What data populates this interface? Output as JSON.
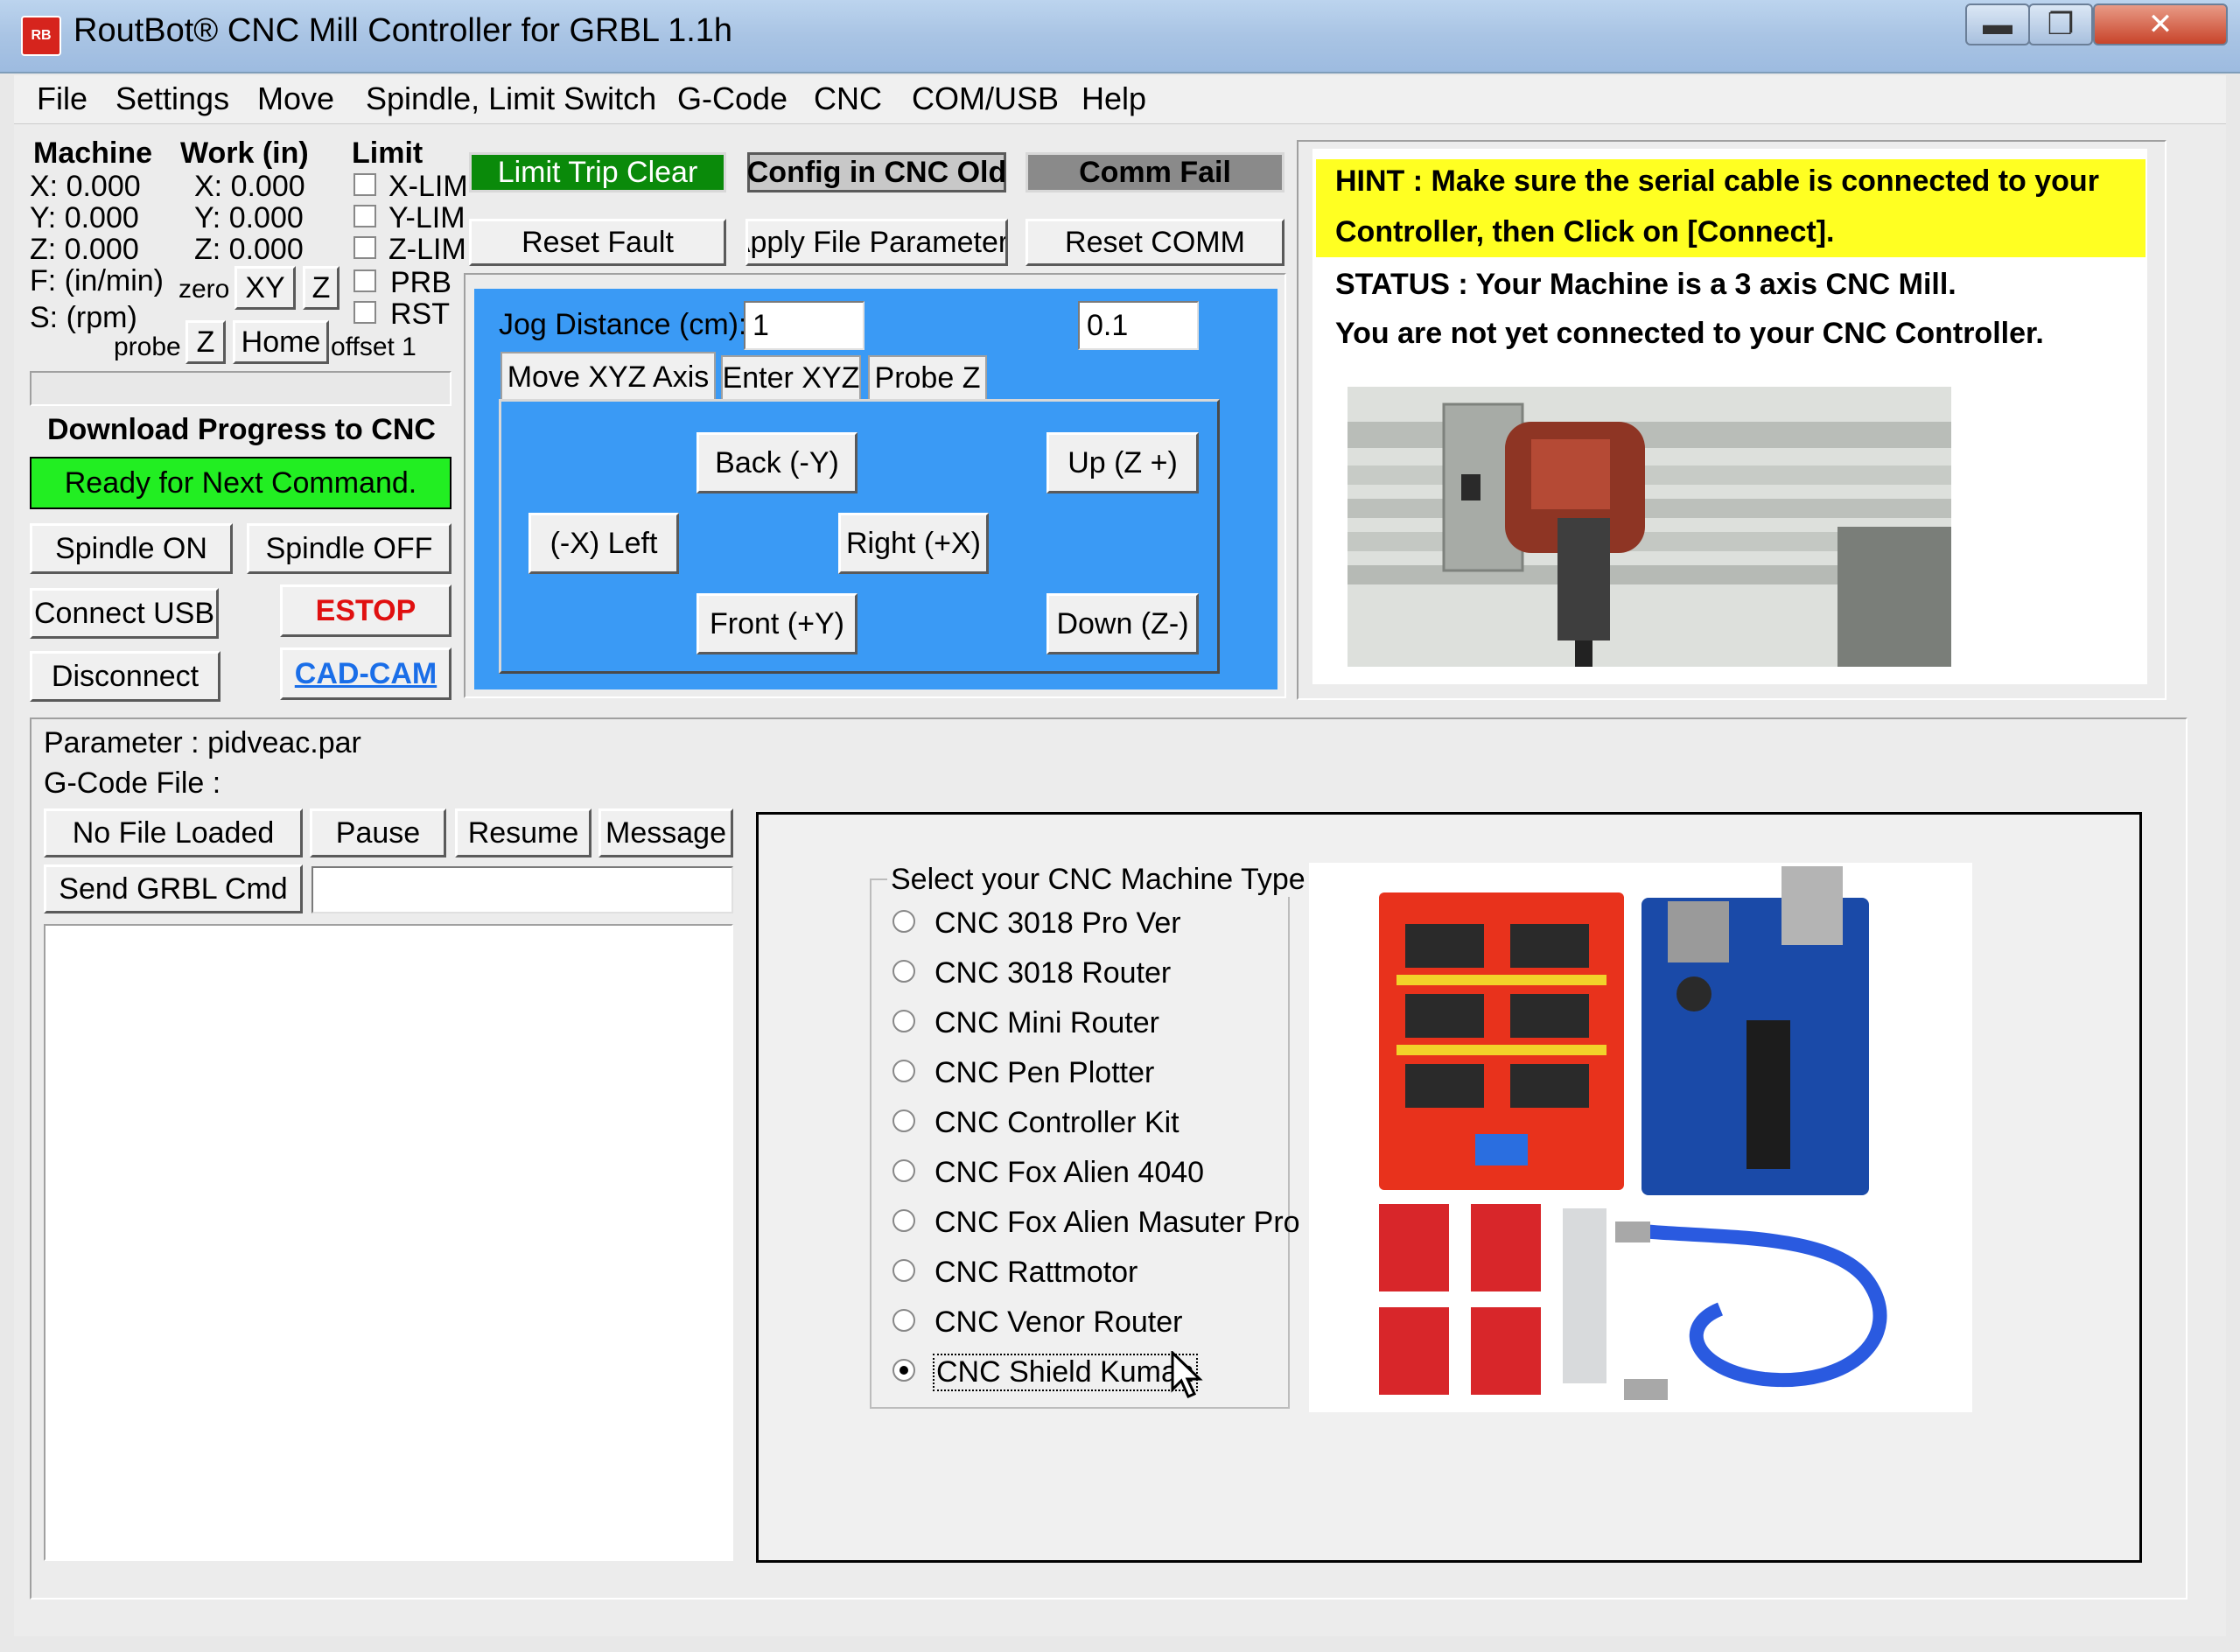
{
  "window": {
    "title": "RoutBot® CNC Mill Controller for GRBL 1.1h",
    "icon_label": "RB",
    "min_glyph": "▬",
    "max_glyph": "❐",
    "close_glyph": "✕"
  },
  "menu": [
    "File",
    "Settings",
    "Move",
    "Spindle, Limit Switch",
    "G-Code",
    "CNC",
    "COM/USB",
    "Help"
  ],
  "coords": {
    "machine_header": "Machine",
    "work_header": "Work (in)",
    "limit_header": "Limit",
    "machine": [
      "X: 0.000",
      "Y: 0.000",
      "Z: 0.000",
      "F: (in/min)",
      "S: (rpm)"
    ],
    "work": [
      "X: 0.000",
      "Y: 0.000",
      "Z: 0.000"
    ],
    "limits": [
      "X-LIM",
      "Y-LIM",
      "Z-LIM",
      "PRB",
      "RST"
    ],
    "zero_label": "zero",
    "zero_xy": "XY",
    "zero_z": "Z",
    "probe_label": "probe",
    "probe_z": "Z",
    "home": "Home",
    "offset_label": "offset 1"
  },
  "progress": {
    "title": "Download Progress to CNC",
    "status": "Ready for Next Command."
  },
  "controls": {
    "spindle_on": "Spindle ON",
    "spindle_off": "Spindle OFF",
    "connect_usb": "Connect USB",
    "estop": "ESTOP",
    "disconnect": "Disconnect",
    "cadcam": "CAD-CAM"
  },
  "status_boxes": {
    "limit_trip": "Limit Trip Clear",
    "config": "Config in CNC Old",
    "comm": "Comm Fail",
    "reset_fault": "Reset Fault",
    "apply_params": "Apply File Parameters",
    "reset_comm": "Reset COMM"
  },
  "jog": {
    "distance_label": "Jog Distance (cm):",
    "distance_value": "1",
    "z_distance_value": "0.1",
    "tabs": [
      "Move XYZ Axis",
      "Enter XYZ",
      "Probe Z"
    ],
    "back": "Back  (-Y)",
    "up": "Up (Z +)",
    "left": "(-X) Left",
    "right": "Right  (+X)",
    "front": "Front  (+Y)",
    "down": "Down (Z-)"
  },
  "hint": {
    "line1": "HINT    : Make sure the serial cable is connected to your",
    "line2": "Controller, then Click on [Connect].",
    "status1": "STATUS : Your Machine is a 3 axis CNC Mill.",
    "status2": "You are not yet connected to your CNC Controller."
  },
  "gcode": {
    "parameter": "Parameter : pidveac.par",
    "file": "G-Code File :",
    "no_file": "No File Loaded",
    "pause": "Pause",
    "resume": "Resume",
    "message": "Message",
    "send_cmd": "Send GRBL Cmd",
    "cmd_value": ""
  },
  "machine_type": {
    "title": "Select your CNC Machine Type",
    "options": [
      "CNC 3018 Pro Ver",
      "CNC 3018 Router",
      "CNC Mini Router",
      "CNC Pen Plotter",
      "CNC Controller Kit",
      "CNC Fox Alien 4040",
      "CNC Fox Alien Masuter Pro",
      "CNC Rattmotor",
      "CNC Venor Router",
      "CNC Shield Kuman"
    ],
    "selected_index": 9
  },
  "colors": {
    "limit_trip_bg": "#0a8a0a",
    "ready_bg": "#22ee22",
    "jog_bg": "#3a9af5",
    "hint_bg": "#ffff22",
    "estop_color": "#e01010",
    "cadcam_color": "#1a6ee8"
  },
  "icons": {
    "cursor": "arrow-cursor-icon"
  }
}
